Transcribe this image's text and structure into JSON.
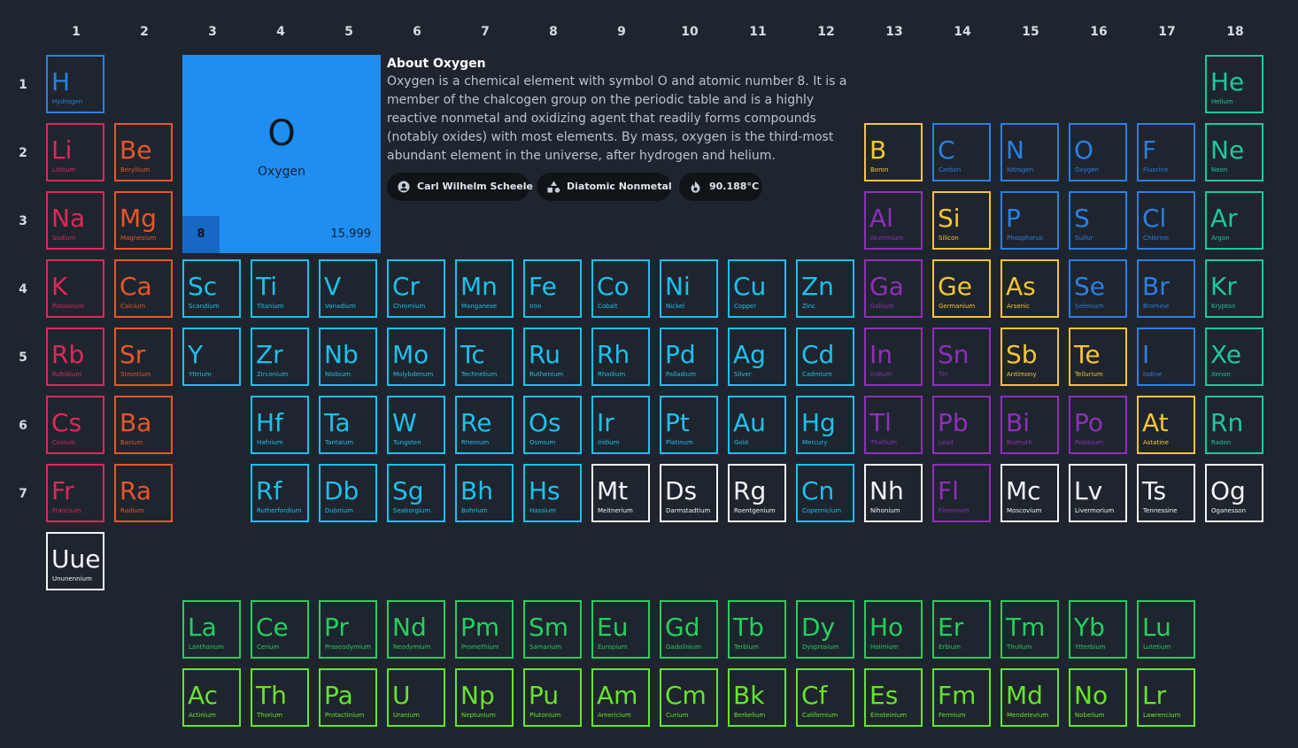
{
  "groups": [
    "1",
    "2",
    "3",
    "4",
    "5",
    "6",
    "7",
    "8",
    "9",
    "10",
    "11",
    "12",
    "13",
    "14",
    "15",
    "16",
    "17",
    "18"
  ],
  "periods": [
    "1",
    "2",
    "3",
    "4",
    "5",
    "6",
    "7"
  ],
  "featured": {
    "symbol": "O",
    "name": "Oxygen",
    "number": "8",
    "mass": "15.999",
    "about_title": "About Oxygen",
    "about_text": "Oxygen is a chemical element with symbol O and atomic number 8. It is a member of the chalcogen group on the periodic table and is a highly reactive nonmetal and oxidizing agent that readily forms compounds (notably oxides) with most elements. By mass, oxygen is the third-most abundant element in the universe, after hydrogen and helium.",
    "chips": [
      {
        "icon": "person-icon",
        "label": "Carl Wilhelm Scheele"
      },
      {
        "icon": "shapes-icon",
        "label": "Diatomic Nonmetal"
      },
      {
        "icon": "flame-icon",
        "label": "90.188°C"
      }
    ]
  },
  "colors": {
    "background": "#1f252e",
    "alkali_metal": "#e1265a",
    "alkaline_earth": "#e8562a",
    "transition_metal": "#1ac2ee",
    "post_transition": "#8e2fbb",
    "metalloid": "#f4c632",
    "reactive_nonmetal": "#2b80e3",
    "noble_gas": "#1cc99a",
    "unknown": "#f2f4f6",
    "lanthanide": "#23d05e",
    "actinide": "#66e529",
    "featured_fill": "#1f8ef0"
  },
  "elements": [
    {
      "symbol": "H",
      "name": "Hydrogen",
      "category": "reactive",
      "group": 1,
      "period": 1
    },
    {
      "symbol": "He",
      "name": "Helium",
      "category": "noble",
      "group": 18,
      "period": 1
    },
    {
      "symbol": "Li",
      "name": "Lithium",
      "category": "alkali",
      "group": 1,
      "period": 2
    },
    {
      "symbol": "Be",
      "name": "Beryllium",
      "category": "alkaline",
      "group": 2,
      "period": 2
    },
    {
      "symbol": "B",
      "name": "Boron",
      "category": "metalloid",
      "group": 13,
      "period": 2
    },
    {
      "symbol": "C",
      "name": "Carbon",
      "category": "reactive",
      "group": 14,
      "period": 2
    },
    {
      "symbol": "N",
      "name": "Nitrogen",
      "category": "reactive",
      "group": 15,
      "period": 2
    },
    {
      "symbol": "O",
      "name": "Oxygen",
      "category": "reactive",
      "group": 16,
      "period": 2
    },
    {
      "symbol": "F",
      "name": "Fluorine",
      "category": "reactive",
      "group": 17,
      "period": 2
    },
    {
      "symbol": "Ne",
      "name": "Neon",
      "category": "noble",
      "group": 18,
      "period": 2
    },
    {
      "symbol": "Na",
      "name": "Sodium",
      "category": "alkali",
      "group": 1,
      "period": 3
    },
    {
      "symbol": "Mg",
      "name": "Magnesium",
      "category": "alkaline",
      "group": 2,
      "period": 3
    },
    {
      "symbol": "Al",
      "name": "Aluminium",
      "category": "post",
      "group": 13,
      "period": 3
    },
    {
      "symbol": "Si",
      "name": "Silicon",
      "category": "metalloid",
      "group": 14,
      "period": 3
    },
    {
      "symbol": "P",
      "name": "Phosphorus",
      "category": "reactive",
      "group": 15,
      "period": 3
    },
    {
      "symbol": "S",
      "name": "Sulfur",
      "category": "reactive",
      "group": 16,
      "period": 3
    },
    {
      "symbol": "Cl",
      "name": "Chlorine",
      "category": "reactive",
      "group": 17,
      "period": 3
    },
    {
      "symbol": "Ar",
      "name": "Argon",
      "category": "noble",
      "group": 18,
      "period": 3
    },
    {
      "symbol": "K",
      "name": "Potassium",
      "category": "alkali",
      "group": 1,
      "period": 4
    },
    {
      "symbol": "Ca",
      "name": "Calcium",
      "category": "alkaline",
      "group": 2,
      "period": 4
    },
    {
      "symbol": "Sc",
      "name": "Scandium",
      "category": "transition",
      "group": 3,
      "period": 4
    },
    {
      "symbol": "Ti",
      "name": "Titanium",
      "category": "transition",
      "group": 4,
      "period": 4
    },
    {
      "symbol": "V",
      "name": "Vanadium",
      "category": "transition",
      "group": 5,
      "period": 4
    },
    {
      "symbol": "Cr",
      "name": "Chromium",
      "category": "transition",
      "group": 6,
      "period": 4
    },
    {
      "symbol": "Mn",
      "name": "Manganese",
      "category": "transition",
      "group": 7,
      "period": 4
    },
    {
      "symbol": "Fe",
      "name": "Iron",
      "category": "transition",
      "group": 8,
      "period": 4
    },
    {
      "symbol": "Co",
      "name": "Cobalt",
      "category": "transition",
      "group": 9,
      "period": 4
    },
    {
      "symbol": "Ni",
      "name": "Nickel",
      "category": "transition",
      "group": 10,
      "period": 4
    },
    {
      "symbol": "Cu",
      "name": "Copper",
      "category": "transition",
      "group": 11,
      "period": 4
    },
    {
      "symbol": "Zn",
      "name": "Zinc",
      "category": "transition",
      "group": 12,
      "period": 4
    },
    {
      "symbol": "Ga",
      "name": "Gallium",
      "category": "post",
      "group": 13,
      "period": 4
    },
    {
      "symbol": "Ge",
      "name": "Germanium",
      "category": "metalloid",
      "group": 14,
      "period": 4
    },
    {
      "symbol": "As",
      "name": "Arsenic",
      "category": "metalloid",
      "group": 15,
      "period": 4
    },
    {
      "symbol": "Se",
      "name": "Selenium",
      "category": "reactive",
      "group": 16,
      "period": 4
    },
    {
      "symbol": "Br",
      "name": "Bromine",
      "category": "reactive",
      "group": 17,
      "period": 4
    },
    {
      "symbol": "Kr",
      "name": "Krypton",
      "category": "noble",
      "group": 18,
      "period": 4
    },
    {
      "symbol": "Rb",
      "name": "Rubidium",
      "category": "alkali",
      "group": 1,
      "period": 5
    },
    {
      "symbol": "Sr",
      "name": "Strontium",
      "category": "alkaline",
      "group": 2,
      "period": 5
    },
    {
      "symbol": "Y",
      "name": "Yttrium",
      "category": "transition",
      "group": 3,
      "period": 5
    },
    {
      "symbol": "Zr",
      "name": "Zirconium",
      "category": "transition",
      "group": 4,
      "period": 5
    },
    {
      "symbol": "Nb",
      "name": "Niobium",
      "category": "transition",
      "group": 5,
      "period": 5
    },
    {
      "symbol": "Mo",
      "name": "Molybdenum",
      "category": "transition",
      "group": 6,
      "period": 5
    },
    {
      "symbol": "Tc",
      "name": "Technetium",
      "category": "transition",
      "group": 7,
      "period": 5
    },
    {
      "symbol": "Ru",
      "name": "Ruthenium",
      "category": "transition",
      "group": 8,
      "period": 5
    },
    {
      "symbol": "Rh",
      "name": "Rhodium",
      "category": "transition",
      "group": 9,
      "period": 5
    },
    {
      "symbol": "Pd",
      "name": "Palladium",
      "category": "transition",
      "group": 10,
      "period": 5
    },
    {
      "symbol": "Ag",
      "name": "Silver",
      "category": "transition",
      "group": 11,
      "period": 5
    },
    {
      "symbol": "Cd",
      "name": "Cadmium",
      "category": "transition",
      "group": 12,
      "period": 5
    },
    {
      "symbol": "In",
      "name": "Indium",
      "category": "post",
      "group": 13,
      "period": 5
    },
    {
      "symbol": "Sn",
      "name": "Tin",
      "category": "post",
      "group": 14,
      "period": 5
    },
    {
      "symbol": "Sb",
      "name": "Antimony",
      "category": "metalloid",
      "group": 15,
      "period": 5
    },
    {
      "symbol": "Te",
      "name": "Tellurium",
      "category": "metalloid",
      "group": 16,
      "period": 5
    },
    {
      "symbol": "I",
      "name": "Iodine",
      "category": "reactive",
      "group": 17,
      "period": 5
    },
    {
      "symbol": "Xe",
      "name": "Xenon",
      "category": "noble",
      "group": 18,
      "period": 5
    },
    {
      "symbol": "Cs",
      "name": "Cesium",
      "category": "alkali",
      "group": 1,
      "period": 6
    },
    {
      "symbol": "Ba",
      "name": "Barium",
      "category": "alkaline",
      "group": 2,
      "period": 6
    },
    {
      "symbol": "Hf",
      "name": "Hafnium",
      "category": "transition",
      "group": 4,
      "period": 6
    },
    {
      "symbol": "Ta",
      "name": "Tantalum",
      "category": "transition",
      "group": 5,
      "period": 6
    },
    {
      "symbol": "W",
      "name": "Tungsten",
      "category": "transition",
      "group": 6,
      "period": 6
    },
    {
      "symbol": "Re",
      "name": "Rhenium",
      "category": "transition",
      "group": 7,
      "period": 6
    },
    {
      "symbol": "Os",
      "name": "Osmium",
      "category": "transition",
      "group": 8,
      "period": 6
    },
    {
      "symbol": "Ir",
      "name": "Iridium",
      "category": "transition",
      "group": 9,
      "period": 6
    },
    {
      "symbol": "Pt",
      "name": "Platinum",
      "category": "transition",
      "group": 10,
      "period": 6
    },
    {
      "symbol": "Au",
      "name": "Gold",
      "category": "transition",
      "group": 11,
      "period": 6
    },
    {
      "symbol": "Hg",
      "name": "Mercury",
      "category": "transition",
      "group": 12,
      "period": 6
    },
    {
      "symbol": "Tl",
      "name": "Thallium",
      "category": "post",
      "group": 13,
      "period": 6
    },
    {
      "symbol": "Pb",
      "name": "Lead",
      "category": "post",
      "group": 14,
      "period": 6
    },
    {
      "symbol": "Bi",
      "name": "Bismuth",
      "category": "post",
      "group": 15,
      "period": 6
    },
    {
      "symbol": "Po",
      "name": "Polonium",
      "category": "post",
      "group": 16,
      "period": 6
    },
    {
      "symbol": "At",
      "name": "Astatine",
      "category": "metalloid",
      "group": 17,
      "period": 6
    },
    {
      "symbol": "Rn",
      "name": "Radon",
      "category": "noble",
      "group": 18,
      "period": 6
    },
    {
      "symbol": "Fr",
      "name": "Francium",
      "category": "alkali",
      "group": 1,
      "period": 7
    },
    {
      "symbol": "Ra",
      "name": "Radium",
      "category": "alkaline",
      "group": 2,
      "period": 7
    },
    {
      "symbol": "Rf",
      "name": "Rutherfordium",
      "category": "transition",
      "group": 4,
      "period": 7
    },
    {
      "symbol": "Db",
      "name": "Dubnium",
      "category": "transition",
      "group": 5,
      "period": 7
    },
    {
      "symbol": "Sg",
      "name": "Seaborgium",
      "category": "transition",
      "group": 6,
      "period": 7
    },
    {
      "symbol": "Bh",
      "name": "Bohrium",
      "category": "transition",
      "group": 7,
      "period": 7
    },
    {
      "symbol": "Hs",
      "name": "Hassium",
      "category": "transition",
      "group": 8,
      "period": 7
    },
    {
      "symbol": "Mt",
      "name": "Meitnerium",
      "category": "unknown",
      "group": 9,
      "period": 7
    },
    {
      "symbol": "Ds",
      "name": "Darmstadtium",
      "category": "unknown",
      "group": 10,
      "period": 7
    },
    {
      "symbol": "Rg",
      "name": "Roentgenium",
      "category": "unknown",
      "group": 11,
      "period": 7
    },
    {
      "symbol": "Cn",
      "name": "Copernicium",
      "category": "transition",
      "group": 12,
      "period": 7
    },
    {
      "symbol": "Nh",
      "name": "Nihonium",
      "category": "unknown",
      "group": 13,
      "period": 7
    },
    {
      "symbol": "Fl",
      "name": "Flerovium",
      "category": "post",
      "group": 14,
      "period": 7
    },
    {
      "symbol": "Mc",
      "name": "Moscovium",
      "category": "unknown",
      "group": 15,
      "period": 7
    },
    {
      "symbol": "Lv",
      "name": "Livermorium",
      "category": "unknown",
      "group": 16,
      "period": 7
    },
    {
      "symbol": "Ts",
      "name": "Tennessine",
      "category": "unknown",
      "group": 17,
      "period": 7
    },
    {
      "symbol": "Og",
      "name": "Oganesson",
      "category": "unknown",
      "group": 18,
      "period": 7
    },
    {
      "symbol": "Uue",
      "name": "Ununennium",
      "category": "unknown",
      "group": 1,
      "period": 8
    },
    {
      "symbol": "La",
      "name": "Lanthanum",
      "category": "lanth",
      "group": 3,
      "period": 9
    },
    {
      "symbol": "Ce",
      "name": "Cerium",
      "category": "lanth",
      "group": 4,
      "period": 9
    },
    {
      "symbol": "Pr",
      "name": "Praseodymium",
      "category": "lanth",
      "group": 5,
      "period": 9
    },
    {
      "symbol": "Nd",
      "name": "Neodymium",
      "category": "lanth",
      "group": 6,
      "period": 9
    },
    {
      "symbol": "Pm",
      "name": "Promethium",
      "category": "lanth",
      "group": 7,
      "period": 9
    },
    {
      "symbol": "Sm",
      "name": "Samarium",
      "category": "lanth",
      "group": 8,
      "period": 9
    },
    {
      "symbol": "Eu",
      "name": "Europium",
      "category": "lanth",
      "group": 9,
      "period": 9
    },
    {
      "symbol": "Gd",
      "name": "Gadolinium",
      "category": "lanth",
      "group": 10,
      "period": 9
    },
    {
      "symbol": "Tb",
      "name": "Terbium",
      "category": "lanth",
      "group": 11,
      "period": 9
    },
    {
      "symbol": "Dy",
      "name": "Dysprosium",
      "category": "lanth",
      "group": 12,
      "period": 9
    },
    {
      "symbol": "Ho",
      "name": "Holmium",
      "category": "lanth",
      "group": 13,
      "period": 9
    },
    {
      "symbol": "Er",
      "name": "Erbium",
      "category": "lanth",
      "group": 14,
      "period": 9
    },
    {
      "symbol": "Tm",
      "name": "Thulium",
      "category": "lanth",
      "group": 15,
      "period": 9
    },
    {
      "symbol": "Yb",
      "name": "Ytterbium",
      "category": "lanth",
      "group": 16,
      "period": 9
    },
    {
      "symbol": "Lu",
      "name": "Lutetium",
      "category": "lanth",
      "group": 17,
      "period": 9
    },
    {
      "symbol": "Ac",
      "name": "Actinium",
      "category": "actin",
      "group": 3,
      "period": 10
    },
    {
      "symbol": "Th",
      "name": "Thorium",
      "category": "actin",
      "group": 4,
      "period": 10
    },
    {
      "symbol": "Pa",
      "name": "Protactinium",
      "category": "actin",
      "group": 5,
      "period": 10
    },
    {
      "symbol": "U",
      "name": "Uranium",
      "category": "actin",
      "group": 6,
      "period": 10
    },
    {
      "symbol": "Np",
      "name": "Neptunium",
      "category": "actin",
      "group": 7,
      "period": 10
    },
    {
      "symbol": "Pu",
      "name": "Plutonium",
      "category": "actin",
      "group": 8,
      "period": 10
    },
    {
      "symbol": "Am",
      "name": "Americium",
      "category": "actin",
      "group": 9,
      "period": 10
    },
    {
      "symbol": "Cm",
      "name": "Curium",
      "category": "actin",
      "group": 10,
      "period": 10
    },
    {
      "symbol": "Bk",
      "name": "Berkelium",
      "category": "actin",
      "group": 11,
      "period": 10
    },
    {
      "symbol": "Cf",
      "name": "Californium",
      "category": "actin",
      "group": 12,
      "period": 10
    },
    {
      "symbol": "Es",
      "name": "Einsteinium",
      "category": "actin",
      "group": 13,
      "period": 10
    },
    {
      "symbol": "Fm",
      "name": "Fermium",
      "category": "actin",
      "group": 14,
      "period": 10
    },
    {
      "symbol": "Md",
      "name": "Mendelevium",
      "category": "actin",
      "group": 15,
      "period": 10
    },
    {
      "symbol": "No",
      "name": "Nobelium",
      "category": "actin",
      "group": 16,
      "period": 10
    },
    {
      "symbol": "Lr",
      "name": "Lawrencium",
      "category": "actin",
      "group": 17,
      "period": 10
    }
  ]
}
